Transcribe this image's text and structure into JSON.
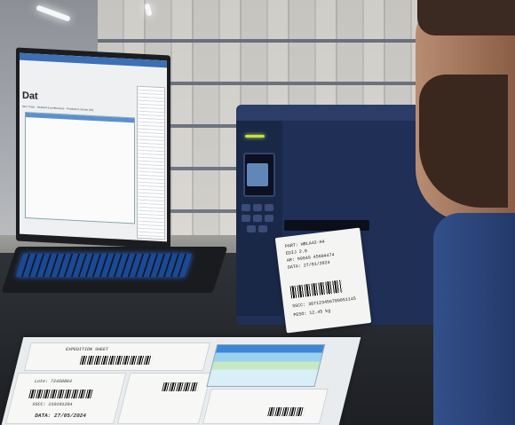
{
  "laptop": {
    "app_title": "Dat",
    "app_subtitle": "Item Track · Seafood & preferences · Production Stores (0X)"
  },
  "printer_label": {
    "lines": [
      "PART: WBLA42-H4",
      "EDIJ 2.0",
      "AR: 99049 45604474",
      "DATA: 27/01/2024",
      "SSCC: 387123456789051145",
      "PESO: 12.45 kg"
    ]
  },
  "documents": {
    "sheet_texts": [
      "EXPEDITION SHEET",
      "Lote: 72450864",
      "SSCC: 210191204",
      "DATA: 27/05/2024"
    ]
  }
}
